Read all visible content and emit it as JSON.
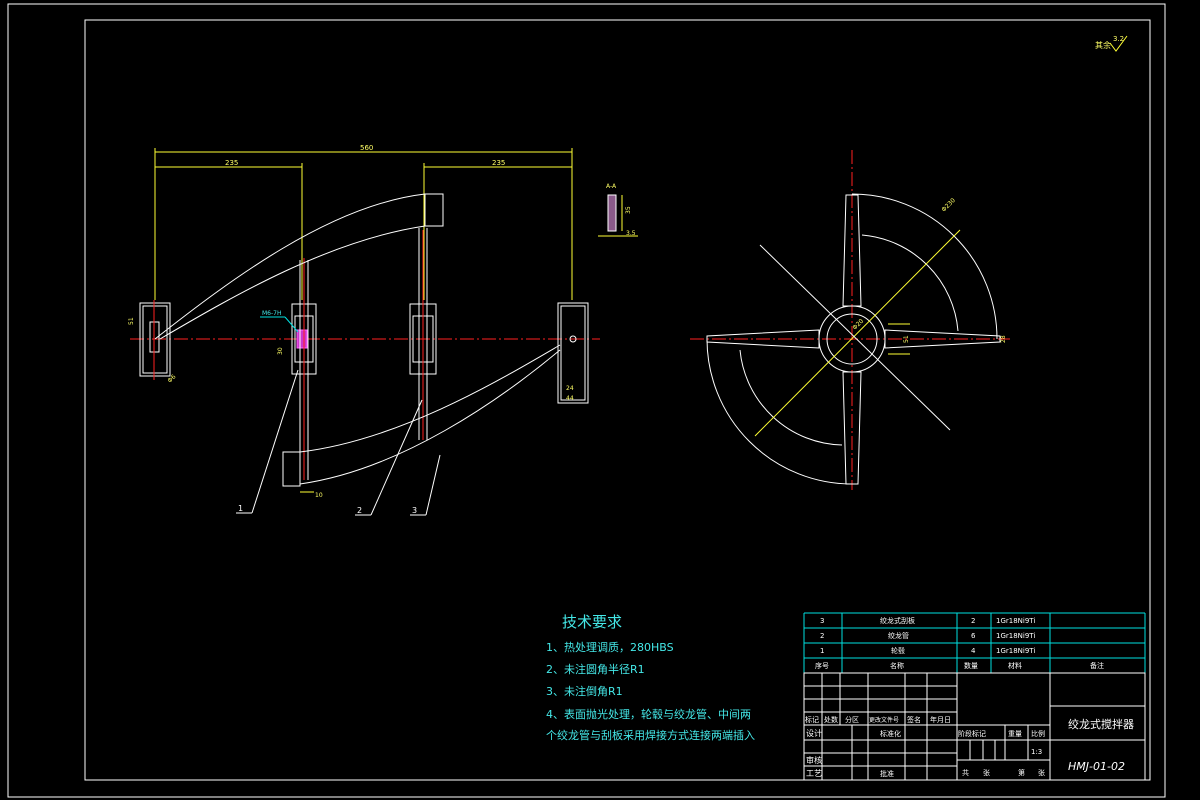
{
  "surface_finish": "3.2",
  "surface_finish_label": "其余",
  "dimensions": {
    "overall": "560",
    "left_span": "235",
    "right_span": "235",
    "hub_height": "51",
    "bolt_spec": "M6-7H",
    "bolt_height": "30",
    "blade_thickness": "10",
    "hub_width_24": "24",
    "hub_width_44": "44",
    "hole": "Φ6",
    "section_label": "A-A",
    "section_width": "35",
    "section_thickness": "3.5",
    "side_diameter": "Φ230",
    "side_hub": "Φ20",
    "side_width_51": "51",
    "side_blade_28": "28"
  },
  "part_callouts": [
    "1",
    "2",
    "3"
  ],
  "tech_requirements": {
    "title": "技术要求",
    "items": [
      "1、热处理调质，280HBS",
      "2、未注圆角半径R1",
      "3、未注倒角R1",
      "4、表面抛光处理，轮毂与绞龙管、中间两",
      "个绞龙管与刮板采用焊接方式连接两端插入"
    ]
  },
  "bom": {
    "rows": [
      {
        "no": "3",
        "name": "绞龙式刮板",
        "qty": "2",
        "material": "1Gr18Ni9Ti",
        "note": ""
      },
      {
        "no": "2",
        "name": "绞龙管",
        "qty": "6",
        "material": "1Gr18Ni9Ti",
        "note": ""
      },
      {
        "no": "1",
        "name": "轮毂",
        "qty": "4",
        "material": "1Gr18Ni9Ti",
        "note": ""
      }
    ],
    "header": {
      "no": "序号",
      "name": "名称",
      "qty": "数量",
      "material": "材料",
      "note": "备注"
    }
  },
  "title_block": {
    "title": "绞龙式搅拌器",
    "drawing_no": "HMJ-01-02",
    "scale": "1:3",
    "labels": {
      "mark": "标记",
      "count": "处数",
      "zone": "分区",
      "change_doc": "更改文件号",
      "sign": "签名",
      "date": "年月日",
      "design": "设计",
      "standard": "标准化",
      "stage": "阶段标记",
      "weight": "重量",
      "ratio": "比例",
      "review": "审核",
      "process": "工艺",
      "approve": "批准",
      "total": "共",
      "sheets": "张",
      "page": "第",
      "sheet2": "张"
    }
  }
}
